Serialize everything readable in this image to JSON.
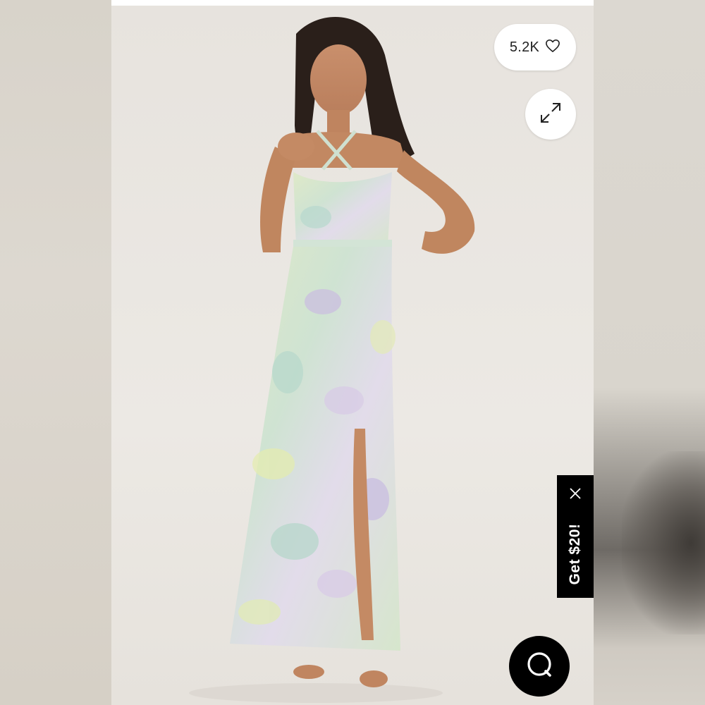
{
  "product_viewer": {
    "likes": {
      "count": "5.2K",
      "icon": "heart-outline-icon"
    },
    "expand": {
      "icon": "expand-arrows-icon"
    },
    "promo": {
      "label": "Get $20!",
      "close_icon": "close-x-icon"
    },
    "chat": {
      "icon": "chat-bubble-icon"
    }
  },
  "colors": {
    "pill_background": "#ffffff",
    "promo_background": "#000000",
    "chat_background": "#000000",
    "backdrop": "#e9e6e1"
  }
}
